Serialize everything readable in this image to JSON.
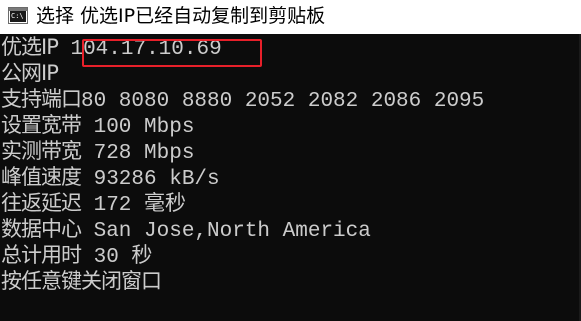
{
  "window": {
    "icon_text": "C:\\",
    "title": "选择 优选IP已经自动复制到剪贴板"
  },
  "console": {
    "lines": [
      {
        "label": "优选IP",
        "value": " 104.17.10.69"
      },
      {
        "label": "公网IP",
        "value": ""
      },
      {
        "label": "支持端口",
        "value": "80 8080 8880 2052 2082 2086 2095"
      },
      {
        "label": "设置宽带",
        "value": " 100 Mbps"
      },
      {
        "label": "实测带宽",
        "value": " 728 Mbps"
      },
      {
        "label": "峰值速度",
        "value": " 93286 kB/s"
      },
      {
        "label": "往返延迟",
        "value": " 172 毫秒"
      },
      {
        "label": "数据中心",
        "value": " San Jose,North America"
      },
      {
        "label": "总计用时",
        "value": " 30 秒"
      },
      {
        "label": "按任意键关闭窗口",
        "value": ""
      }
    ]
  },
  "colors": {
    "console_bg": "#0c0c0c",
    "console_text": "#cccccc",
    "highlight": "#e8202a"
  }
}
